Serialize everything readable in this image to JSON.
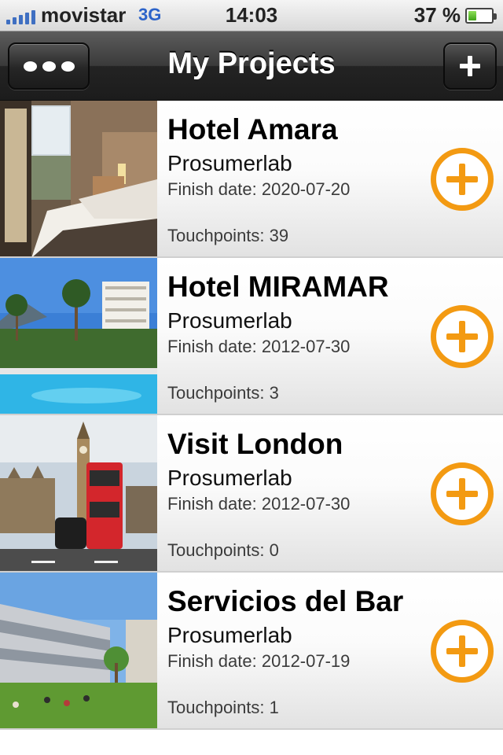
{
  "status_bar": {
    "carrier": "movistar",
    "network": "3G",
    "time": "14:03",
    "battery_percent": "37 %",
    "battery_level": 0.37,
    "signal_bars": 5
  },
  "nav": {
    "title": "My Projects",
    "menu_icon": "more-dots-icon",
    "add_icon": "plus-icon"
  },
  "projects": [
    {
      "title": "Hotel Amara",
      "company": "Prosumerlab",
      "finish_label": "Finish date:",
      "finish_date": "2020-07-20",
      "touch_label": "Touchpoints:",
      "touchpoints": "39"
    },
    {
      "title": "Hotel MIRAMAR",
      "company": "Prosumerlab",
      "finish_label": "Finish date:",
      "finish_date": "2012-07-30",
      "touch_label": "Touchpoints:",
      "touchpoints": "3"
    },
    {
      "title": "Visit London",
      "company": "Prosumerlab",
      "finish_label": "Finish date:",
      "finish_date": "2012-07-30",
      "touch_label": "Touchpoints:",
      "touchpoints": "0"
    },
    {
      "title": "Servicios del Bar",
      "company": "Prosumerlab",
      "finish_label": "Finish date:",
      "finish_date": "2012-07-19",
      "touch_label": "Touchpoints:",
      "touchpoints": "1"
    }
  ],
  "colors": {
    "accent_orange": "#f39a12",
    "navbar_dark": "#232323",
    "network_blue": "#2c63c9"
  }
}
